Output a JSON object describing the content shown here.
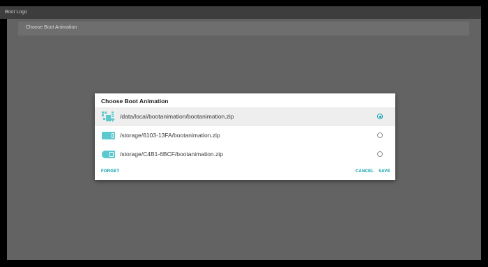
{
  "header": {
    "title": "Boot Logo"
  },
  "settings": {
    "row_label": "Choose Boot Animation"
  },
  "dialog": {
    "title": "Choose Boot Animation",
    "options": [
      {
        "icon": "local-storage-icon",
        "label": "/data/local/bootanimation/bootanimation.zip",
        "selected": true
      },
      {
        "icon": "sd-card-icon",
        "label": "/storage/6103-13FA/bootanimation.zip",
        "selected": false
      },
      {
        "icon": "usb-drive-icon",
        "label": "/storage/C4B1-6BCF/bootanimation.zip",
        "selected": false
      }
    ],
    "buttons": {
      "forget": "FORGET",
      "cancel": "CANCEL",
      "save": "SAVE"
    }
  },
  "colors": {
    "accent": "#009aa9",
    "icon": "#5ec8cf",
    "dim_background": "#636363",
    "titlebar": "#3d3d3d"
  }
}
